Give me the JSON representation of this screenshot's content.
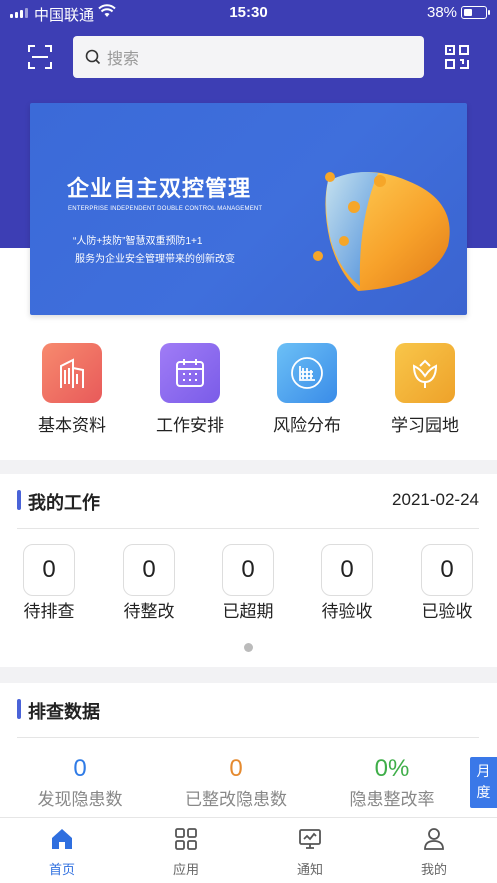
{
  "status_bar": {
    "carrier": "中国联通",
    "time": "15:30",
    "battery": "38%"
  },
  "header": {
    "search_placeholder": "搜索",
    "icons": {
      "scan": "scan-icon",
      "qr": "qr-code-icon"
    }
  },
  "banner": {
    "title": "企业自主双控管理",
    "subtitle_en": "ENTERPRISE INDEPENDENT DOUBLE CONTROL MANAGEMENT",
    "line1": "“人防+技防”智慧双重预防1+1",
    "line2": "服务为企业安全管理带来的创新改变"
  },
  "quick_menu": [
    {
      "label": "基本资料",
      "icon": "building-icon",
      "color": "#ef6a5a"
    },
    {
      "label": "工作安排",
      "icon": "calendar-icon",
      "color": "#8a6cf0"
    },
    {
      "label": "风险分布",
      "icon": "risk-grid-icon",
      "color": "#4aa6ef"
    },
    {
      "label": "学习园地",
      "icon": "flower-icon",
      "color": "#f2b233"
    }
  ],
  "my_work": {
    "title": "我的工作",
    "date": "2021-02-24",
    "items": [
      {
        "value": "0",
        "label": "待排查"
      },
      {
        "value": "0",
        "label": "待整改"
      },
      {
        "value": "0",
        "label": "已超期"
      },
      {
        "value": "0",
        "label": "待验收"
      },
      {
        "value": "0",
        "label": "已验收"
      }
    ]
  },
  "check_data": {
    "title": "排查数据",
    "stats": [
      {
        "value": "0",
        "label": "发现隐患数",
        "color": "#2f7be6"
      },
      {
        "value": "0",
        "label": "已整改隐患数",
        "color": "#e58a2f"
      },
      {
        "value": "0%",
        "label": "隐患整改率",
        "color": "#3fae49"
      }
    ],
    "period_tab": "月度"
  },
  "tabs": [
    {
      "label": "首页",
      "icon": "home-icon",
      "active": true
    },
    {
      "label": "应用",
      "icon": "apps-grid-icon",
      "active": false
    },
    {
      "label": "通知",
      "icon": "monitor-icon",
      "active": false
    },
    {
      "label": "我的",
      "icon": "user-icon",
      "active": false
    }
  ]
}
